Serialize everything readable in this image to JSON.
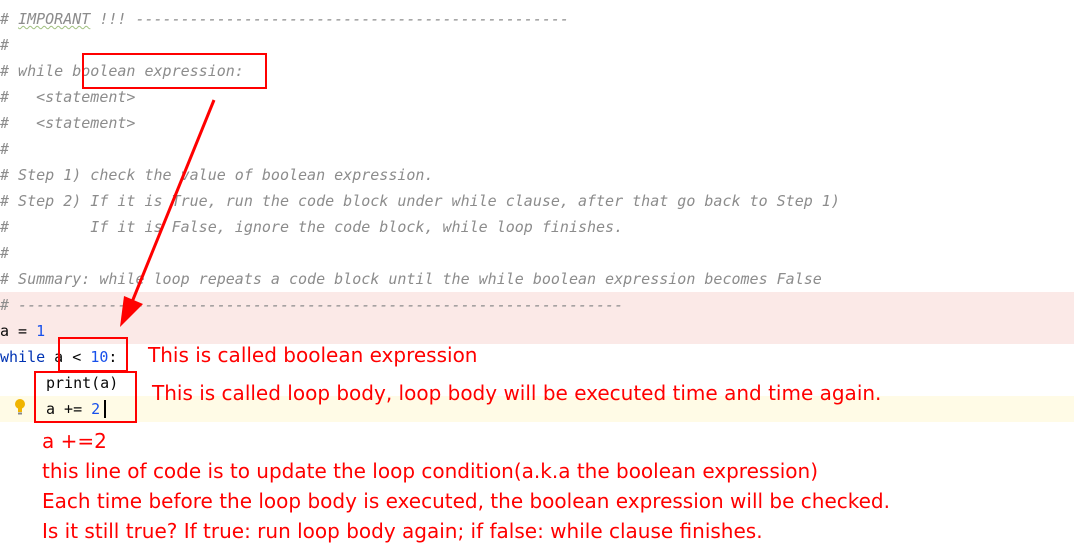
{
  "editor": {
    "lines": [
      "# IMPORANT !!! ------------------------------------------------",
      "#",
      "# while boolean expression:",
      "#   <statement>",
      "#   <statement>",
      "#",
      "# Step 1) check the value of boolean expression.",
      "# Step 2) If it is True, run the code block under while clause, after that go back to Step 1)",
      "#         If it is False, ignore the code block, while loop finishes.",
      "#",
      "# Summary: while loop repeats a code block until the while boolean expression becomes False",
      "# -------------------------------------------------------------------"
    ],
    "code": {
      "line1_var": "a",
      "line1_op": " = ",
      "line1_val": "1",
      "line2_kw": "while",
      "line2_cond_a": " a < ",
      "line2_cond_num": "10",
      "line2_colon": ":",
      "line3": "print(a)",
      "line4_pre": "a += ",
      "line4_num": "2"
    }
  },
  "annotations": {
    "boolean_expression": "This is called boolean expression",
    "loop_body": "This is called loop body, loop body will be executed time and time again.",
    "notes": [
      "a +=2",
      "this line of code is to update the loop condition(a.k.a the boolean expression)",
      "Each time before the loop body is executed, the boolean expression will be checked.",
      "Is it still true? If true: run loop body again; if false: while clause finishes."
    ]
  },
  "colors": {
    "annotation": "#ff0000",
    "comment": "#8c8c8c",
    "keyword": "#0033b3",
    "number": "#1750eb"
  }
}
